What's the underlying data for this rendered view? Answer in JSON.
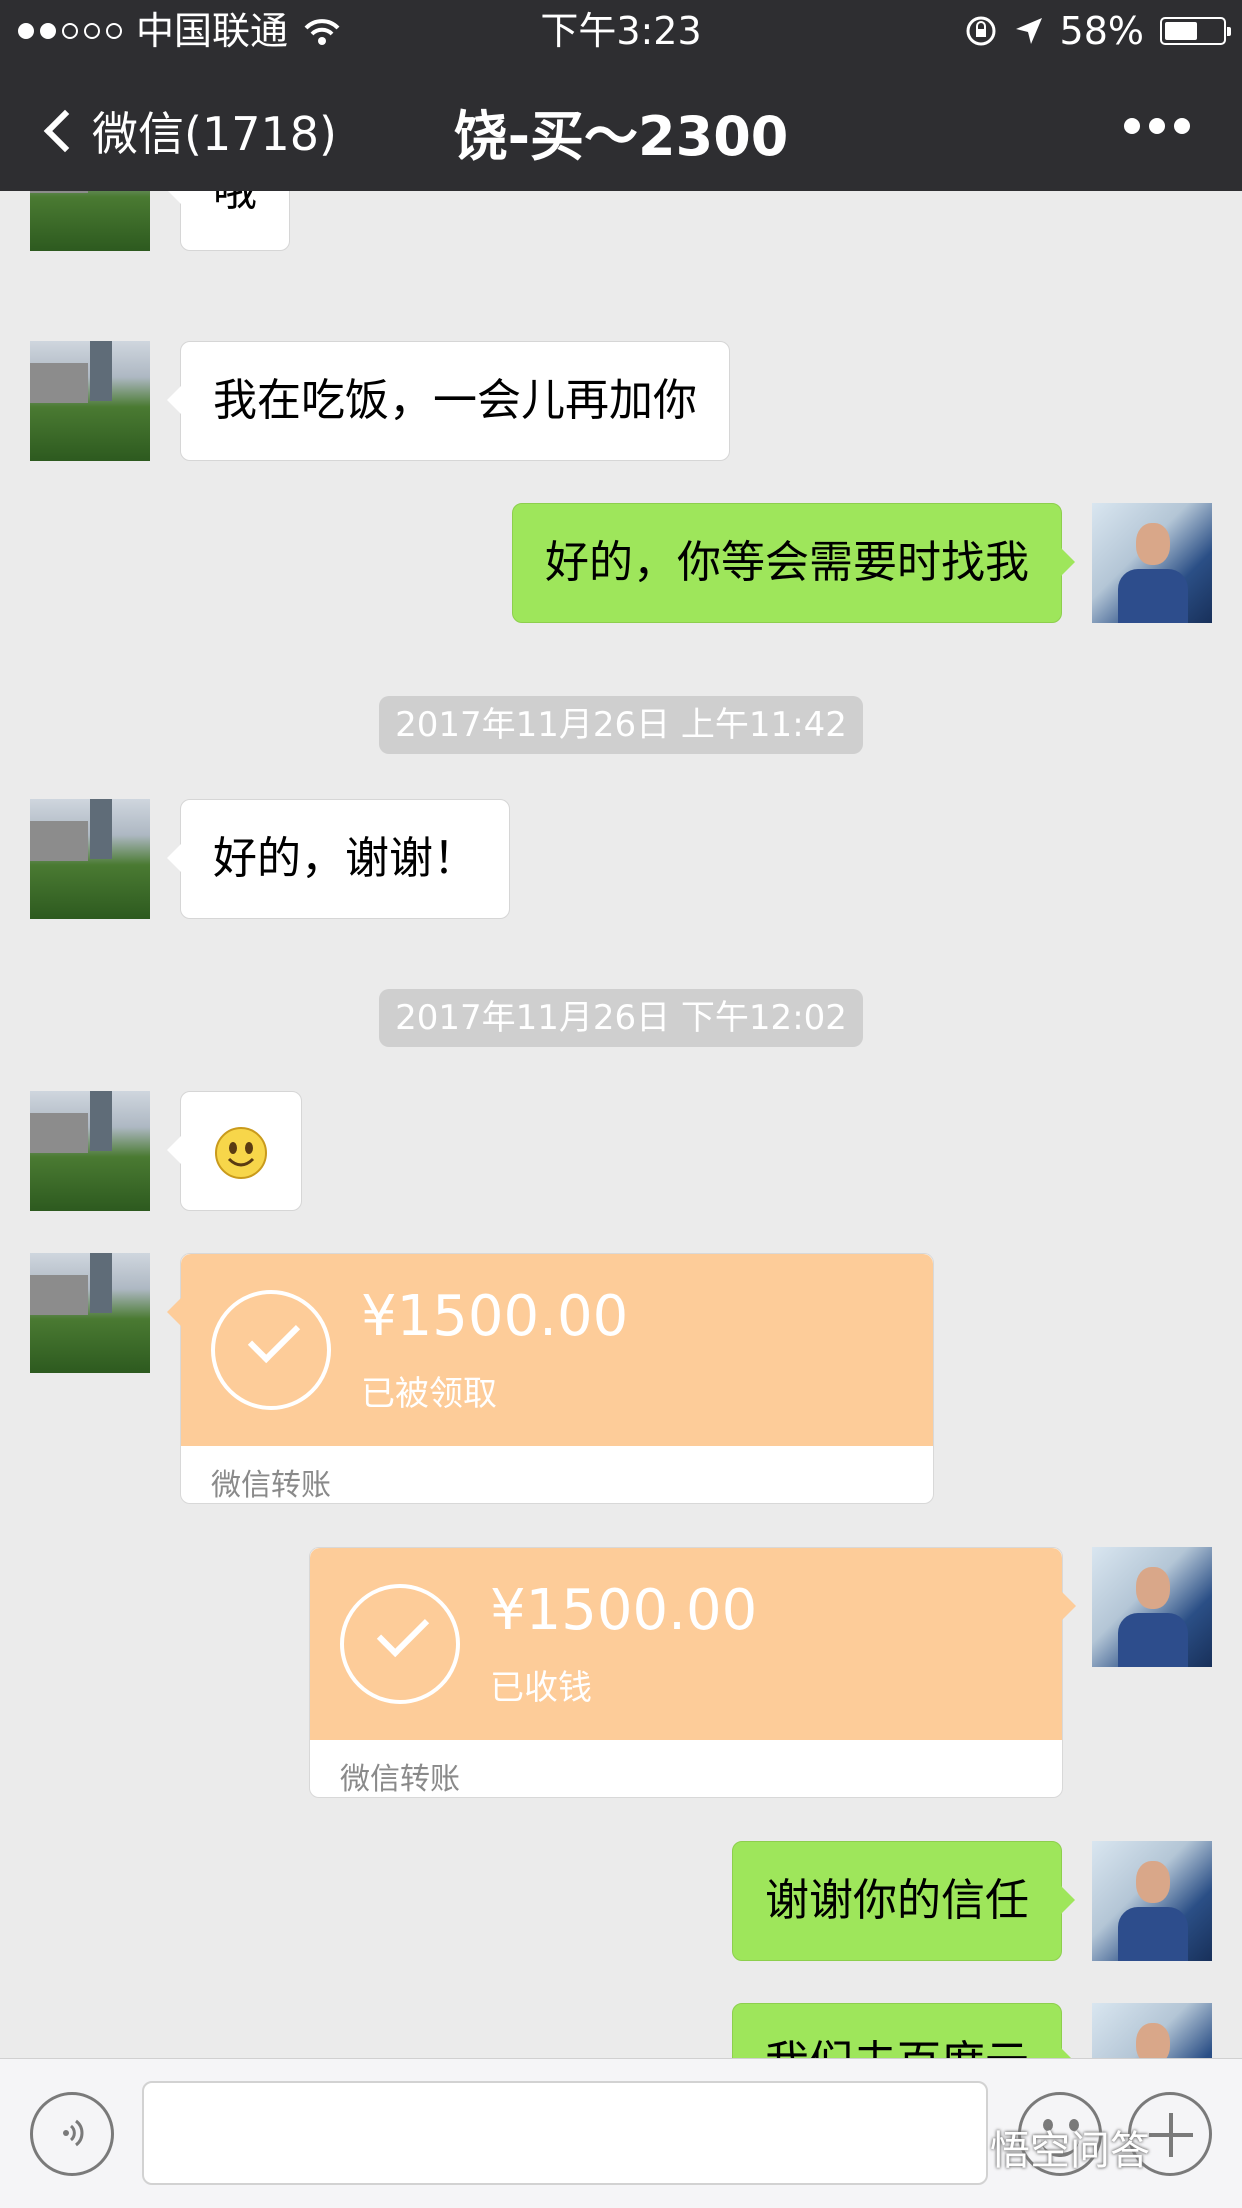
{
  "status_bar": {
    "carrier": "中国联通",
    "time": "下午3:23",
    "battery": "58%",
    "battery_level": 0.58
  },
  "nav": {
    "back_label": "微信(1718)",
    "title": "饶-买～2300"
  },
  "messages": [
    {
      "side": "them",
      "type": "text",
      "text": "哦"
    },
    {
      "side": "them",
      "type": "text",
      "text": "我在吃饭，一会儿再加你"
    },
    {
      "side": "me",
      "type": "text",
      "text": "好的，你等会需要时找我"
    },
    {
      "type": "timestamp",
      "text": "2017年11月26日 上午11:42"
    },
    {
      "side": "them",
      "type": "text",
      "text": "好的，谢谢！"
    },
    {
      "type": "timestamp",
      "text": "2017年11月26日 下午12:02"
    },
    {
      "side": "them",
      "type": "emoji",
      "icon": "smiley-emoji"
    },
    {
      "side": "them",
      "type": "transfer",
      "amount": "¥1500.00",
      "status": "已被领取",
      "footer": "微信转账"
    },
    {
      "side": "me",
      "type": "transfer",
      "amount": "¥1500.00",
      "status": "已收钱",
      "footer": "微信转账"
    },
    {
      "side": "me",
      "type": "text",
      "text": "谢谢你的信任"
    },
    {
      "side": "me",
      "type": "text",
      "text": "我们去百度云"
    }
  ],
  "input_bar": {
    "value": "",
    "icons": [
      "voice-icon",
      "emoji-icon",
      "plus-icon"
    ]
  },
  "watermark": "悟空问答",
  "colors": {
    "nav_bg": "#2e2e31",
    "chat_bg": "#ebebeb",
    "my_bubble": "#9ee65b",
    "their_bubble": "#ffffff",
    "transfer": "#fdcc99"
  }
}
